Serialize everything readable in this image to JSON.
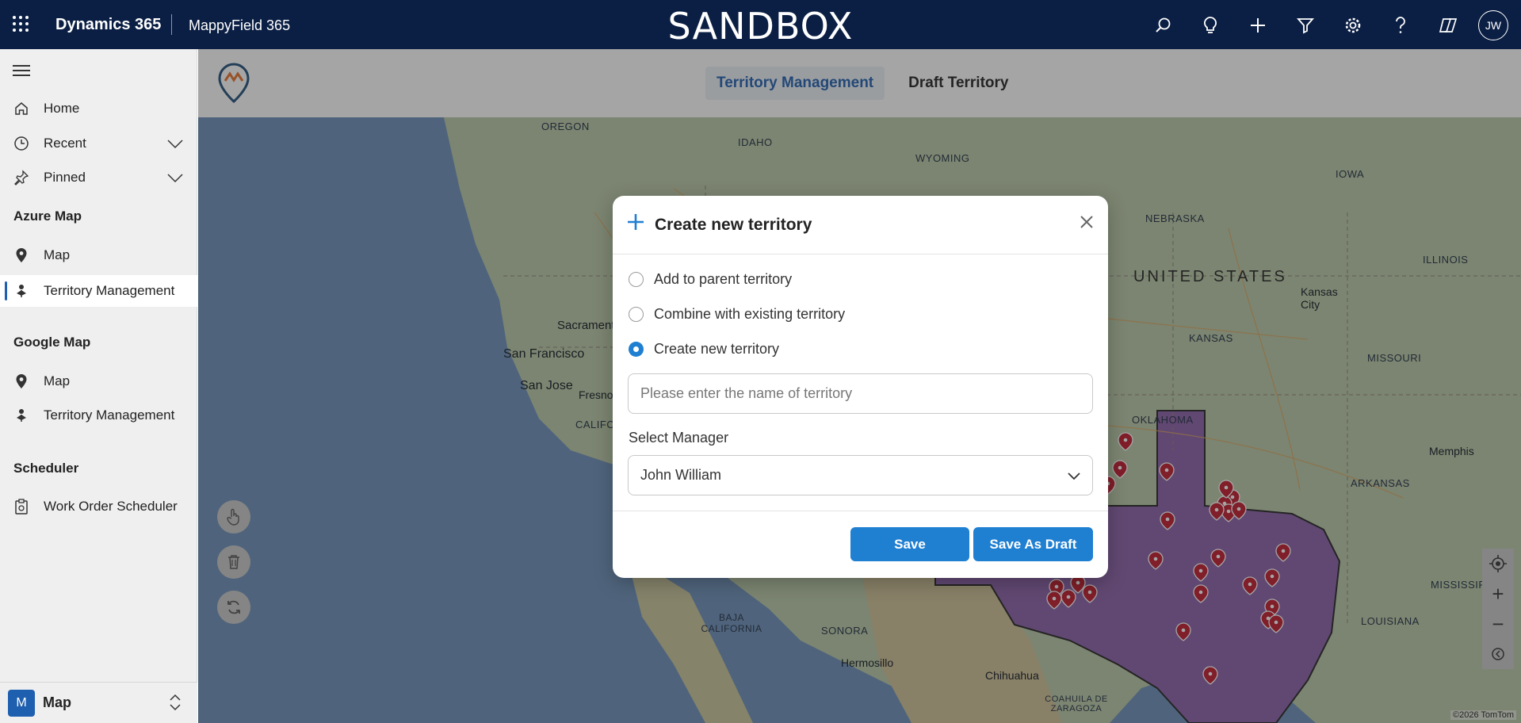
{
  "topbar": {
    "brand": "Dynamics 365",
    "app_name": "MappyField 365",
    "environment": "SANDBOX",
    "user_initials": "JW",
    "icons": [
      "search-icon",
      "lightbulb-icon",
      "plus-icon",
      "filter-icon",
      "settings-icon",
      "help-icon",
      "copilot-icon"
    ]
  },
  "sidebar": {
    "items": [
      {
        "label": "Home",
        "icon": "home-icon"
      },
      {
        "label": "Recent",
        "icon": "clock-icon"
      },
      {
        "label": "Pinned",
        "icon": "pin-icon"
      }
    ],
    "groups": [
      {
        "title": "Azure Map",
        "items": [
          {
            "label": "Map"
          },
          {
            "label": "Territory Management",
            "active": true
          }
        ]
      },
      {
        "title": "Google Map",
        "items": [
          {
            "label": "Map"
          },
          {
            "label": "Territory Management"
          }
        ]
      },
      {
        "title": "Scheduler",
        "items": [
          {
            "label": "Work Order Scheduler"
          }
        ]
      }
    ],
    "area": {
      "badge": "M",
      "label": "Map"
    }
  },
  "app": {
    "tabs": [
      {
        "label": "Territory Management",
        "active": true
      },
      {
        "label": "Draft Territory",
        "active": false
      }
    ]
  },
  "map": {
    "labels": {
      "oregon": "OREGON",
      "idaho": "IDAHO",
      "wyoming": "WYOMING",
      "iowa": "IOWA",
      "nebraska": "NEBRASKA",
      "illinois": "ILLINOIS",
      "united_states": "UNITED STATES",
      "kansas_city": "Kansas City",
      "sacramento": "Sacramento",
      "san_francisco": "San Francisco",
      "san_jose": "San Jose",
      "fresno": "Fresno",
      "california": "CALIFO",
      "kansas": "KANSAS",
      "missouri": "MISSOURI",
      "oklahoma": "OKLAHOMA",
      "memphis": "Memphis",
      "arkansas": "ARKANSAS",
      "mississippi": "MISSISSIPP",
      "louisiana": "LOUISIANA",
      "baja_california": "BAJA CALIFORNIA",
      "sonora": "SONORA",
      "hermosillo": "Hermosillo",
      "chihuahua": "Chihuahua",
      "coahuila": "COAHUILA DE ZARAGOZA"
    },
    "credit": "©2026 TomTom"
  },
  "dialog": {
    "title": "Create new territory",
    "options": [
      {
        "label": "Add to parent territory",
        "selected": false
      },
      {
        "label": "Combine with existing territory",
        "selected": false
      },
      {
        "label": "Create new territory",
        "selected": true
      }
    ],
    "name_placeholder": "Please enter the name of territory",
    "manager_label": "Select Manager",
    "manager_value": "John William",
    "save_label": "Save",
    "save_draft_label": "Save As Draft"
  },
  "colors": {
    "topbar": "#0b1f44",
    "accent": "#1f7fd1",
    "territory_fill": "#8b5fa8",
    "marker": "#c0182a"
  }
}
